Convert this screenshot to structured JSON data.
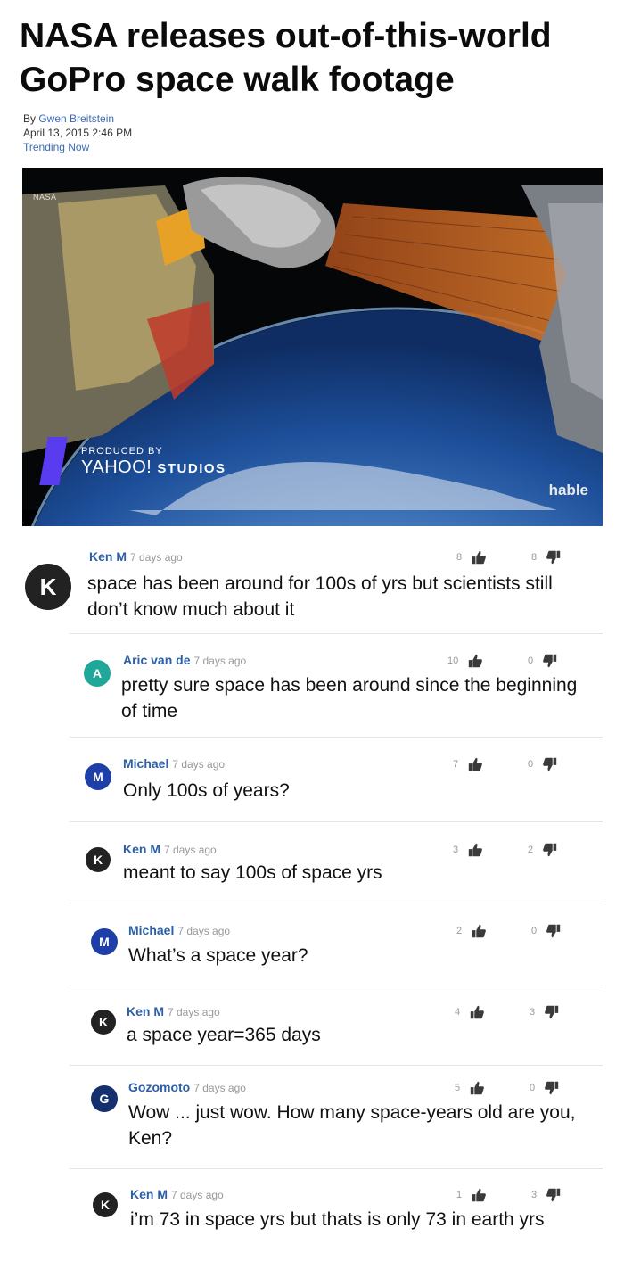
{
  "article": {
    "title": "NASA releases out-of-this-world GoPro space walk footage",
    "by_label": "By ",
    "author": "Gwen Breitstein",
    "date": "April 13, 2015 2:46 PM",
    "section": "Trending Now"
  },
  "video": {
    "nasa_mark": "NASA",
    "produced_by": "PRODUCED BY",
    "yahoo": "YAHOO!",
    "studios": "STUDIOS",
    "watermark": "hable"
  },
  "comments": [
    {
      "initial": "K",
      "author": "Ken M",
      "ago": "7 days ago",
      "text": "space has been around for 100s of yrs but scientists still don’t know much about it",
      "up": "8",
      "down": "8",
      "avatar_color": "#222222"
    },
    {
      "initial": "A",
      "author": "Aric van de",
      "ago": "7 days ago",
      "text": "pretty sure space has been around since the beginning of time",
      "up": "10",
      "down": "0",
      "avatar_color": "#1fa89a"
    },
    {
      "initial": "M",
      "author": "Michael",
      "ago": "7 days ago",
      "text": "Only 100s of years?",
      "up": "7",
      "down": "0",
      "avatar_color": "#1e3fa8"
    },
    {
      "initial": "K",
      "author": "Ken M",
      "ago": "7 days ago",
      "text": "meant to say 100s of space yrs",
      "up": "3",
      "down": "2",
      "avatar_color": "#222222"
    },
    {
      "initial": "M",
      "author": "Michael",
      "ago": "7 days ago",
      "text": "What’s a space year?",
      "up": "2",
      "down": "0",
      "avatar_color": "#1e3fa8"
    },
    {
      "initial": "K",
      "author": "Ken M",
      "ago": "7 days ago",
      "text": "a space year=365 days",
      "up": "4",
      "down": "3",
      "avatar_color": "#222222"
    },
    {
      "initial": "G",
      "author": "Gozomoto",
      "ago": "7 days ago",
      "text": "Wow ... just wow. How many space-years old are you, Ken?",
      "up": "5",
      "down": "0",
      "avatar_color": "#15306e"
    },
    {
      "initial": "K",
      "author": "Ken M",
      "ago": "7 days ago",
      "text": "i’m 73 in space yrs but thats is only 73 in earth yrs",
      "up": "1",
      "down": "3",
      "avatar_color": "#222222"
    }
  ]
}
